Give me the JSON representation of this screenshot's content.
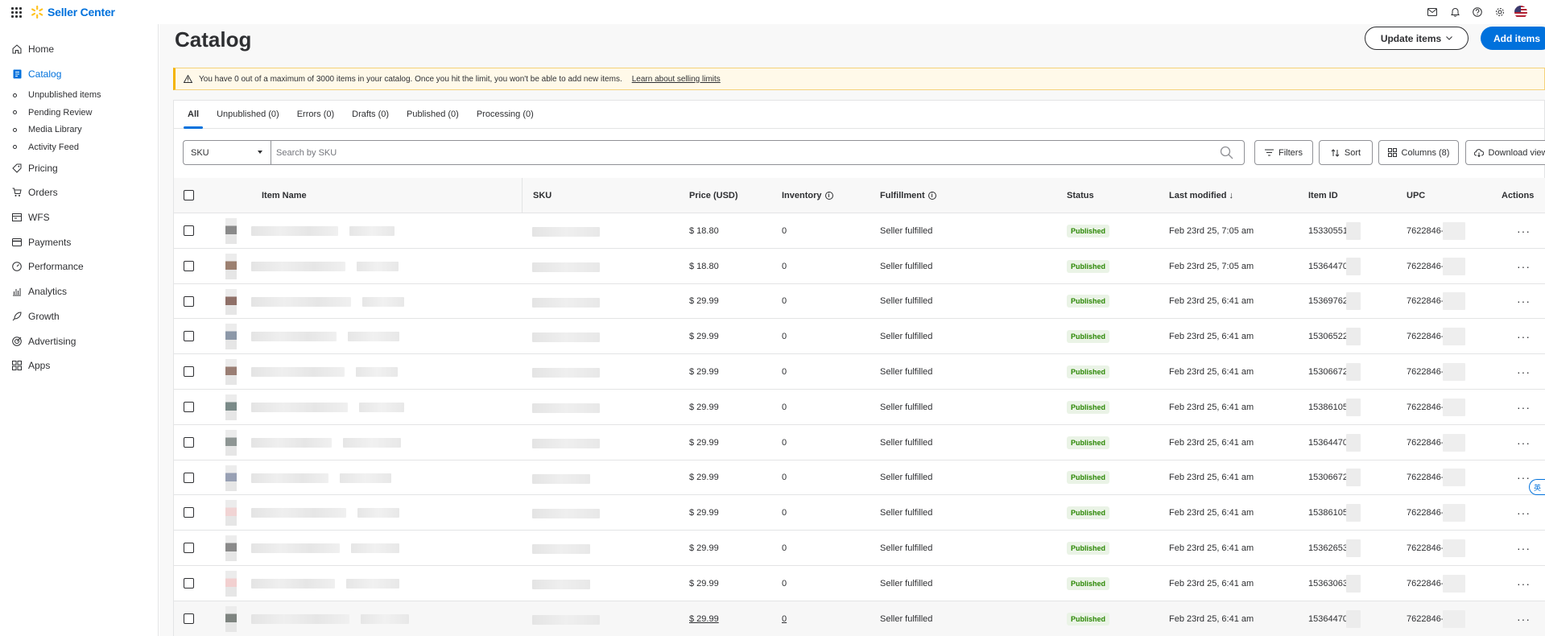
{
  "topbar": {
    "brand": "Seller Center",
    "icons": [
      "mail-icon",
      "bell-icon",
      "help-icon",
      "gear-icon",
      "us-flag-icon"
    ]
  },
  "sidebar": {
    "items": [
      {
        "label": "Home",
        "icon": "home-icon"
      },
      {
        "label": "Catalog",
        "icon": "catalog-icon",
        "active": true
      },
      {
        "label": "Pricing",
        "icon": "tag-icon"
      },
      {
        "label": "Orders",
        "icon": "cart-icon"
      },
      {
        "label": "WFS",
        "icon": "warehouse-icon"
      },
      {
        "label": "Payments",
        "icon": "card-icon"
      },
      {
        "label": "Performance",
        "icon": "gauge-icon"
      },
      {
        "label": "Analytics",
        "icon": "chart-icon"
      },
      {
        "label": "Growth",
        "icon": "rocket-icon"
      },
      {
        "label": "Advertising",
        "icon": "target-icon"
      },
      {
        "label": "Apps",
        "icon": "apps-icon"
      }
    ],
    "catalog_sub": [
      "Unpublished items",
      "Pending Review",
      "Media Library",
      "Activity Feed"
    ]
  },
  "page": {
    "title": "Catalog",
    "update_items": "Update items",
    "add_items": "Add items"
  },
  "alert": {
    "text": "You have 0 out of a maximum of 3000 items in your catalog. Once you hit the limit, you won't be able to add new items.",
    "link": "Learn about selling limits"
  },
  "tabs": [
    "All",
    "Unpublished (0)",
    "Errors (0)",
    "Drafts (0)",
    "Published (0)",
    "Processing (0)"
  ],
  "toolbar": {
    "select_value": "SKU",
    "search_placeholder": "Search by SKU",
    "filters": "Filters",
    "sort": "Sort",
    "columns": "Columns (8)",
    "download": "Download view"
  },
  "table": {
    "headers": {
      "item_name": "Item Name",
      "sku": "SKU",
      "price": "Price (USD)",
      "inventory": "Inventory",
      "fulfillment": "Fulfillment",
      "status": "Status",
      "last_modified": "Last modified ↓",
      "item_id": "Item ID",
      "upc": "UPC",
      "actions": "Actions"
    },
    "rows": [
      {
        "price": "$ 18.80",
        "inventory": "0",
        "fulfillment": "Seller fulfilled",
        "status": "Published",
        "modified": "Feb 23rd 25, 7:05 am",
        "item_id": "15330551",
        "upc": "7622846-",
        "thumb": "#8a8a8a"
      },
      {
        "price": "$ 18.80",
        "inventory": "0",
        "fulfillment": "Seller fulfilled",
        "status": "Published",
        "modified": "Feb 23rd 25, 7:05 am",
        "item_id": "15364470",
        "upc": "7622846-",
        "thumb": "#9c8070"
      },
      {
        "price": "$ 29.99",
        "inventory": "0",
        "fulfillment": "Seller fulfilled",
        "status": "Published",
        "modified": "Feb 23rd 25, 6:41 am",
        "item_id": "15369762",
        "upc": "7622846-",
        "thumb": "#8f7068"
      },
      {
        "price": "$ 29.99",
        "inventory": "0",
        "fulfillment": "Seller fulfilled",
        "status": "Published",
        "modified": "Feb 23rd 25, 6:41 am",
        "item_id": "15306522",
        "upc": "7622846-",
        "thumb": "#8c98a8"
      },
      {
        "price": "$ 29.99",
        "inventory": "0",
        "fulfillment": "Seller fulfilled",
        "status": "Published",
        "modified": "Feb 23rd 25, 6:41 am",
        "item_id": "15306672",
        "upc": "7622846-",
        "thumb": "#9a7e74"
      },
      {
        "price": "$ 29.99",
        "inventory": "0",
        "fulfillment": "Seller fulfilled",
        "status": "Published",
        "modified": "Feb 23rd 25, 6:41 am",
        "item_id": "15386105",
        "upc": "7622846-",
        "thumb": "#7a8a88"
      },
      {
        "price": "$ 29.99",
        "inventory": "0",
        "fulfillment": "Seller fulfilled",
        "status": "Published",
        "modified": "Feb 23rd 25, 6:41 am",
        "item_id": "15364470",
        "upc": "7622846-",
        "thumb": "#8e9694"
      },
      {
        "price": "$ 29.99",
        "inventory": "0",
        "fulfillment": "Seller fulfilled",
        "status": "Published",
        "modified": "Feb 23rd 25, 6:41 am",
        "item_id": "15306672",
        "upc": "7622846-",
        "thumb": "#98a0b4"
      },
      {
        "price": "$ 29.99",
        "inventory": "0",
        "fulfillment": "Seller fulfilled",
        "status": "Published",
        "modified": "Feb 23rd 25, 6:41 am",
        "item_id": "15386105",
        "upc": "7622846-",
        "thumb": "#f1d4d4"
      },
      {
        "price": "$ 29.99",
        "inventory": "0",
        "fulfillment": "Seller fulfilled",
        "status": "Published",
        "modified": "Feb 23rd 25, 6:41 am",
        "item_id": "15362653",
        "upc": "7622846-",
        "thumb": "#8a8a8a"
      },
      {
        "price": "$ 29.99",
        "inventory": "0",
        "fulfillment": "Seller fulfilled",
        "status": "Published",
        "modified": "Feb 23rd 25, 6:41 am",
        "item_id": "15363063",
        "upc": "7622846-",
        "thumb": "#f2d0d0"
      },
      {
        "price": "$ 29.99",
        "inventory": "0",
        "fulfillment": "Seller fulfilled",
        "status": "Published",
        "modified": "Feb 23rd 25, 6:41 am",
        "item_id": "15364470",
        "upc": "7622846-",
        "thumb": "#7e8480"
      }
    ]
  },
  "floating_tab": "英",
  "colors": {
    "accent": "#0071dc",
    "success": "#2a8703",
    "warning": "#f4b400"
  }
}
